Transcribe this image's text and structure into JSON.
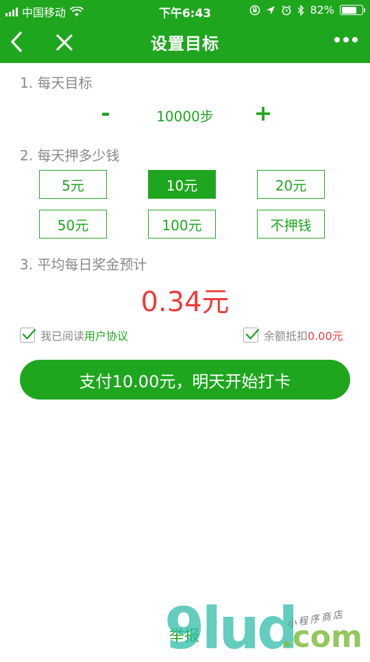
{
  "status_bar": {
    "carrier": "中国移动",
    "time": "下午6:43",
    "battery": "82%",
    "battery_level": 0.82,
    "icons": [
      "signal-icon",
      "wifi-icon",
      "orientation-lock-icon",
      "location-icon",
      "alarm-icon",
      "bluetooth-icon",
      "battery-icon"
    ]
  },
  "nav": {
    "title": "设置目标",
    "icons": [
      "back-chevron-icon",
      "close-icon",
      "more-dots-icon"
    ]
  },
  "step_goal": {
    "title": "1. 每天目标",
    "minus": "-",
    "value": "10000步",
    "plus": "+"
  },
  "deposit": {
    "title": "2. 每天押多少钱",
    "options": [
      "5元",
      "10元",
      "20元",
      "50元",
      "100元",
      "不押钱"
    ],
    "selected": "10元"
  },
  "reward": {
    "title": "3. 平均每日奖金预计",
    "amount": "0.34元"
  },
  "agreement": {
    "prefix": "我已阅读",
    "link": "用户协议",
    "checked": true
  },
  "balance": {
    "label": "余额抵扣",
    "amount": "0.00元",
    "checked": true
  },
  "pay_button": "支付10.00元，明天开始打卡",
  "report_link": "举报",
  "colors": {
    "brand_green": "#1fa61f",
    "reward_red": "#ef3a3a",
    "label_gray": "#888888"
  },
  "watermark": {
    "main": "9lud",
    "dotcom": ".com",
    "sub": "小程序商店"
  }
}
